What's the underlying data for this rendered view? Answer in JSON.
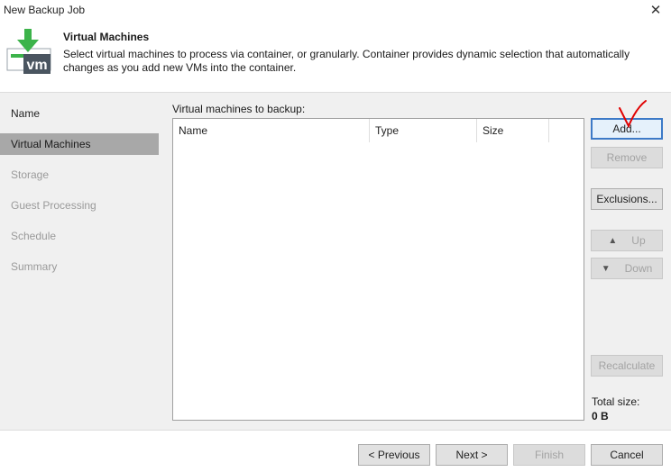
{
  "window": {
    "title": "New Backup Job",
    "close_glyph": "✕"
  },
  "header": {
    "title": "Virtual Machines",
    "description": "Select virtual machines to process via container, or granularly. Container provides dynamic selection that automatically changes as you add new VMs into the container.",
    "logo_text": "vm",
    "accent_color": "#3cb34a"
  },
  "sidebar": {
    "items": [
      {
        "label": "Name",
        "state": "done"
      },
      {
        "label": "Virtual Machines",
        "state": "active"
      },
      {
        "label": "Storage",
        "state": "pending"
      },
      {
        "label": "Guest Processing",
        "state": "pending"
      },
      {
        "label": "Schedule",
        "state": "pending"
      },
      {
        "label": "Summary",
        "state": "pending"
      }
    ]
  },
  "main": {
    "list_label": "Virtual machines to backup:",
    "columns": [
      "Name",
      "Type",
      "Size"
    ],
    "rows": []
  },
  "buttons": {
    "add": "Add...",
    "remove": "Remove",
    "exclusions": "Exclusions...",
    "up": "Up",
    "down": "Down",
    "recalculate": "Recalculate"
  },
  "total": {
    "label": "Total size:",
    "value": "0 B"
  },
  "footer": {
    "previous": "< Previous",
    "next": "Next >",
    "finish": "Finish",
    "cancel": "Cancel"
  },
  "annotation": {
    "color": "#e00000",
    "icon": "checkmark-annotation"
  }
}
